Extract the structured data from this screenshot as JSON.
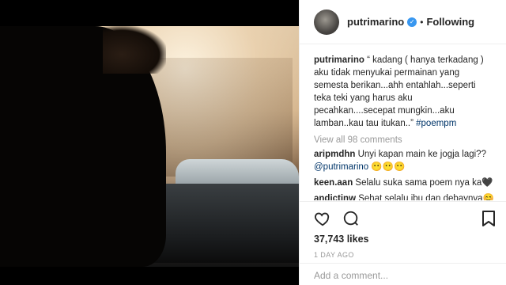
{
  "post": {
    "username": "putrimarino",
    "follow_status": "Following",
    "separator": "•",
    "caption_user": "putrimarino",
    "caption_text": " “ kadang ( hanya terkadang ) aku tidak menyukai permainan yang semesta berikan...ahh entahlah...seperti teka teki yang harus aku pecahkan....secepat mungkin...aku lamban..kau tau itukan..” ",
    "caption_hashtag": "#poempm",
    "view_all_comments": "View all 98 comments",
    "comments": [
      {
        "user": "aripmdhn",
        "text": " Unyi kapan main ke jogja lagi?? ",
        "mention": "@putrimarino",
        "emoji": " 😶😶😶"
      },
      {
        "user": "keen.aan",
        "text": " Selalu suka sama poem nya ka🖤"
      },
      {
        "user": "andictinw",
        "text": " Sehat selalu ibu dan debaynya😊"
      }
    ],
    "likes": "37,743 likes",
    "time_ago": "1 DAY AGO",
    "add_comment_placeholder": "Add a comment..."
  },
  "icons": {
    "verified": "verified-badge-icon",
    "like": "heart-icon",
    "comment": "comment-bubble-icon",
    "save": "bookmark-icon"
  },
  "colors": {
    "verified": "#3897f0",
    "link": "#003569",
    "muted": "#999999"
  }
}
